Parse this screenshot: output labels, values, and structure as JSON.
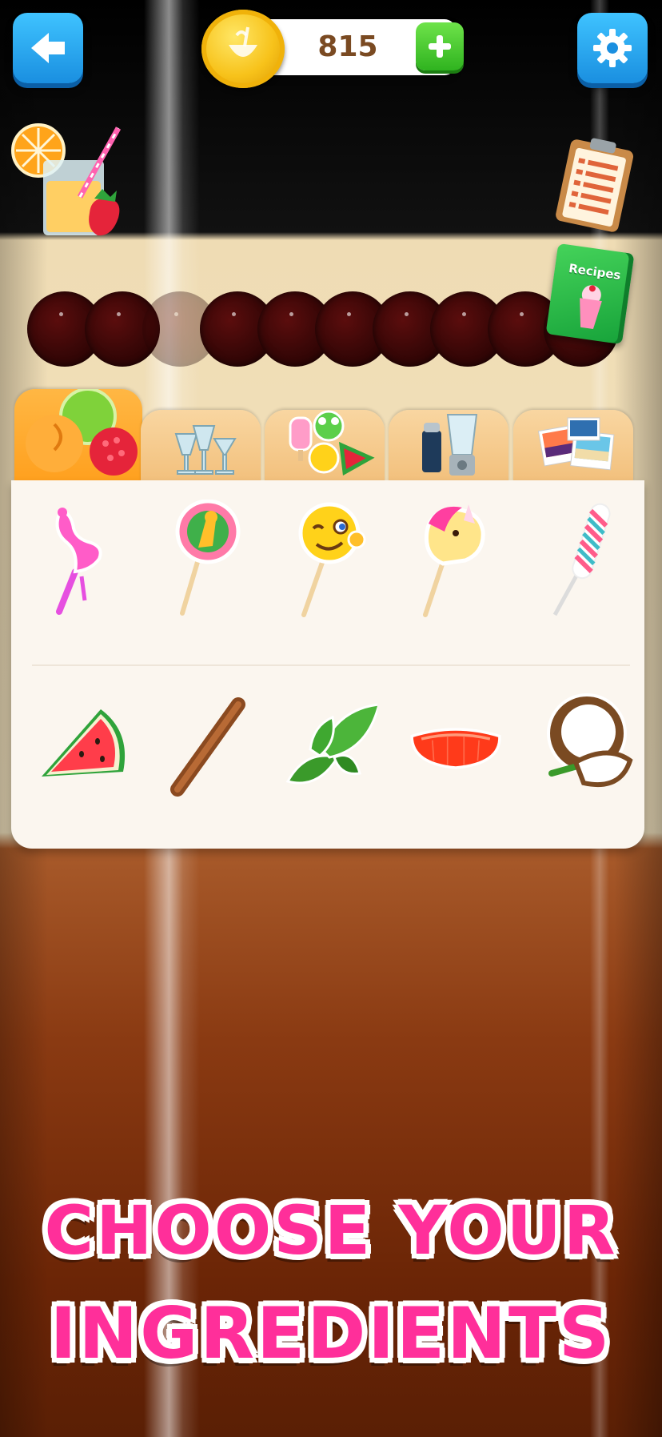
{
  "header": {
    "coins": "815",
    "back_icon": "arrow-left-icon",
    "settings_icon": "gear-icon",
    "add_coins_icon": "plus-icon"
  },
  "glass": {
    "slots_filled": 0,
    "slots_total": 10
  },
  "recipes_book": {
    "label": "Recipes"
  },
  "tabs": [
    {
      "icon": "fruits-icon",
      "active": true
    },
    {
      "icon": "glasses-icon",
      "active": false
    },
    {
      "icon": "stickers-icon",
      "active": false
    },
    {
      "icon": "blender-icon",
      "active": false
    },
    {
      "icon": "photos-icon",
      "active": false
    }
  ],
  "ingredients": {
    "row1": [
      "flamingo-straw-icon",
      "giraffe-lollipop-icon",
      "smiley-lollipop-icon",
      "unicorn-lollipop-icon",
      "twisted-candy-icon"
    ],
    "row2": [
      "watermelon-slice-icon",
      "cinnamon-stick-icon",
      "mint-leaves-icon",
      "orange-jelly-icon",
      "coconut-icon"
    ]
  },
  "caption": {
    "line1": "CHOOSE YOUR",
    "line2": "INGREDIENTS"
  },
  "colors": {
    "accent_blue": "#1a8fe0",
    "accent_green": "#2fb31f",
    "caption_pink": "#ff2f9a",
    "tab_active": "#ffa01e",
    "drink_brown": "#6b2506"
  }
}
